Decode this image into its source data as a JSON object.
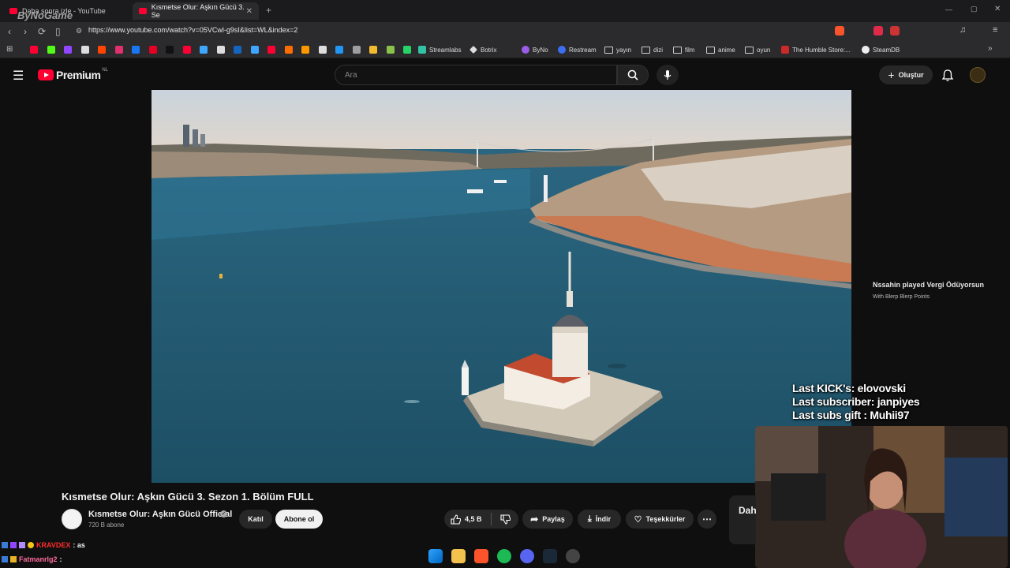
{
  "browser": {
    "tabs": [
      {
        "label": "Daha sonra izle - YouTube",
        "active": false
      },
      {
        "label": "Kısmetse Olur: Aşkın Gücü 3. Se",
        "active": true
      }
    ],
    "url": "https://www.youtube.com/watch?v=05VCwl-g9sI&list=WL&index=2",
    "bookmarks": [
      "Streamlabs",
      "Botrix",
      "ByNo",
      "Restream",
      "yayın",
      "dizi",
      "film",
      "anime",
      "oyun",
      "The Humble Store:...",
      "SteamDB"
    ],
    "overlay_logo": "ByNoGame"
  },
  "youtube": {
    "logo_label": "Premium",
    "region_badge": "NL",
    "search_placeholder": "Ara",
    "create_label": "Oluştur"
  },
  "video": {
    "title": "Kısmetse Olur: Aşkın Gücü 3. Sezon 1. Bölüm FULL",
    "channel_name": "Kısmetse Olur: Aşkın Gücü Official",
    "subscribers": "720 B abone",
    "join_label": "Katıl",
    "subscribe_label": "Abone ol",
    "likes": "4,5 B",
    "share_label": "Paylaş",
    "download_label": "İndir",
    "thanks_label": "Teşekkürler",
    "side_label": "Dah"
  },
  "stream_overlay": {
    "alert_line1": "Nssahin played Vergi Ödüyorsun",
    "alert_line2": "With Blerp Blerp Points",
    "last_kick": "Last KICK's: elovovski",
    "last_sub": "Last subscriber: janpiyes",
    "last_gift": "Last subs gift : Muhii97"
  },
  "chat": [
    {
      "user": "KRAVDEX",
      "message": ": as",
      "color": "#ff2b2b"
    },
    {
      "user": "Fatmanrlg2",
      "message": ":",
      "color": "#ff6b9b"
    }
  ],
  "colors": {
    "yt_red": "#ff0033",
    "bg": "#0f0f0f",
    "pill": "#272727"
  }
}
